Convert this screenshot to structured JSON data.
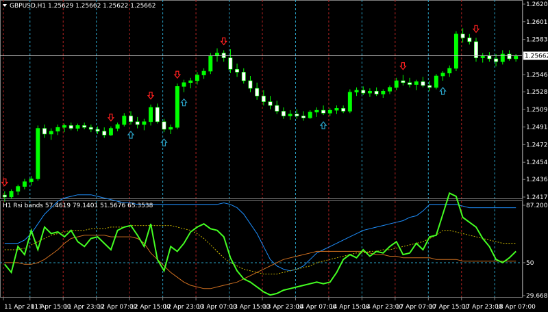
{
  "colors": {
    "background": "#000000",
    "grid": "#1f2a3a",
    "bull_candle": "#00ff00",
    "bear_candle": "#ffffff",
    "wick": "#00ff00",
    "separator_bull": "#2aa4c9",
    "separator_bear": "#b22222",
    "price_line": "#c0c0c0",
    "rsi": "#44ff22",
    "upper_band": "#1e90ff",
    "middle_band": "#c8b400",
    "lower_band": "#d07020",
    "level_line": "#2aa4c9",
    "arrow_up": "#2aa4c9",
    "arrow_down": "#ff2020",
    "frame": "#808080"
  },
  "main_chart": {
    "header": "GBPUSD,H1  1.25629 1.25662 1.25622 1.25662",
    "symbol_menu_icon": "triangle-down-icon",
    "current_price": "1.25662",
    "price_levels": [
      {
        "label": "1.26204",
        "value": 1.26204
      },
      {
        "label": "1.26019",
        "value": 1.26019
      },
      {
        "label": "1.25833",
        "value": 1.25833
      },
      {
        "label": "1.25662",
        "value": 1.25662
      },
      {
        "label": "1.25464",
        "value": 1.25464
      },
      {
        "label": "1.25284",
        "value": 1.25284
      },
      {
        "label": "1.25099",
        "value": 1.25099
      },
      {
        "label": "1.24914",
        "value": 1.24914
      },
      {
        "label": "1.24729",
        "value": 1.24729
      },
      {
        "label": "1.24544",
        "value": 1.24544
      },
      {
        "label": "1.24364",
        "value": 1.24364
      },
      {
        "label": "1.24179",
        "value": 1.24179
      }
    ]
  },
  "indicator": {
    "header": "H1 Rsi bands 57.4619 79.1401 51.5676 65.3538",
    "levels": [
      {
        "label": "87.2005",
        "value": 87.2005
      },
      {
        "label": "50",
        "value": 50
      },
      {
        "label": "29.6680",
        "value": 29.668
      }
    ]
  },
  "time_axis": {
    "labels": [
      "11 Apr 2017",
      "11 Apr 15:00",
      "11 Apr 23:00",
      "12 Apr 07:00",
      "12 Apr 15:00",
      "12 Apr 23:00",
      "13 Apr 07:00",
      "13 Apr 15:00",
      "13 Apr 23:00",
      "14 Apr 07:00",
      "14 Apr 15:00",
      "14 Apr 23:00",
      "17 Apr 07:00",
      "17 Apr 15:00",
      "17 Apr 23:00",
      "18 Apr 07:00"
    ]
  },
  "chart_data": {
    "type": "candlestick",
    "symbol": "GBPUSD",
    "timeframe": "H1",
    "ohlc_header": [
      1.25629,
      1.25662,
      1.25622,
      1.25662
    ],
    "ylim": [
      1.24179,
      1.26204
    ],
    "candles": [
      [
        1.242,
        1.2424,
        1.2413,
        1.2418
      ],
      [
        1.2418,
        1.2426,
        1.2416,
        1.2424
      ],
      [
        1.2424,
        1.2431,
        1.242,
        1.2429
      ],
      [
        1.2429,
        1.2437,
        1.2426,
        1.2434
      ],
      [
        1.2434,
        1.244,
        1.243,
        1.2437
      ],
      [
        1.2437,
        1.2493,
        1.2435,
        1.249
      ],
      [
        1.249,
        1.2494,
        1.248,
        1.2484
      ],
      [
        1.2484,
        1.249,
        1.2478,
        1.2487
      ],
      [
        1.2487,
        1.2494,
        1.2483,
        1.2491
      ],
      [
        1.2491,
        1.2495,
        1.2486,
        1.2493
      ],
      [
        1.2493,
        1.2496,
        1.2488,
        1.249
      ],
      [
        1.249,
        1.2495,
        1.2487,
        1.2493
      ],
      [
        1.2493,
        1.2496,
        1.2489,
        1.2491
      ],
      [
        1.2491,
        1.2494,
        1.2486,
        1.2489
      ],
      [
        1.2489,
        1.2492,
        1.2484,
        1.2487
      ],
      [
        1.2487,
        1.2491,
        1.248,
        1.2483
      ],
      [
        1.2483,
        1.2492,
        1.2482,
        1.249
      ],
      [
        1.249,
        1.2496,
        1.2487,
        1.2494
      ],
      [
        1.2494,
        1.2506,
        1.2492,
        1.2503
      ],
      [
        1.2503,
        1.2508,
        1.2494,
        1.2497
      ],
      [
        1.2497,
        1.2502,
        1.249,
        1.2494
      ],
      [
        1.2494,
        1.25,
        1.2488,
        1.2497
      ],
      [
        1.2497,
        1.2515,
        1.2493,
        1.2512
      ],
      [
        1.2512,
        1.2516,
        1.2495,
        1.2497
      ],
      [
        1.2497,
        1.25,
        1.2486,
        1.2489
      ],
      [
        1.2489,
        1.2494,
        1.2484,
        1.2491
      ],
      [
        1.2491,
        1.2537,
        1.2489,
        1.2534
      ],
      [
        1.2534,
        1.2541,
        1.2528,
        1.2538
      ],
      [
        1.2538,
        1.2543,
        1.2532,
        1.254
      ],
      [
        1.254,
        1.2549,
        1.2536,
        1.2546
      ],
      [
        1.2546,
        1.2553,
        1.2542,
        1.255
      ],
      [
        1.255,
        1.2569,
        1.2547,
        1.2566
      ],
      [
        1.2566,
        1.2574,
        1.256,
        1.2569
      ],
      [
        1.2569,
        1.2572,
        1.256,
        1.2564
      ],
      [
        1.2564,
        1.2573,
        1.2548,
        1.2552
      ],
      [
        1.2552,
        1.2558,
        1.2544,
        1.2549
      ],
      [
        1.2549,
        1.2553,
        1.2537,
        1.254
      ],
      [
        1.254,
        1.2545,
        1.2528,
        1.2532
      ],
      [
        1.2532,
        1.2538,
        1.252,
        1.2524
      ],
      [
        1.2524,
        1.253,
        1.2514,
        1.2518
      ],
      [
        1.2518,
        1.2524,
        1.251,
        1.2514
      ],
      [
        1.2514,
        1.2519,
        1.2505,
        1.2508
      ],
      [
        1.2508,
        1.2512,
        1.25,
        1.2503
      ],
      [
        1.2503,
        1.2509,
        1.2499,
        1.2505
      ],
      [
        1.2505,
        1.251,
        1.25,
        1.2503
      ],
      [
        1.2503,
        1.2508,
        1.2498,
        1.2501
      ],
      [
        1.2501,
        1.2509,
        1.25,
        1.2507
      ],
      [
        1.2507,
        1.2512,
        1.2502,
        1.2509
      ],
      [
        1.2509,
        1.2514,
        1.2504,
        1.2506
      ],
      [
        1.2506,
        1.2511,
        1.2503,
        1.2509
      ],
      [
        1.2509,
        1.2514,
        1.2505,
        1.2511
      ],
      [
        1.2511,
        1.2514,
        1.2506,
        1.2508
      ],
      [
        1.2508,
        1.2531,
        1.2506,
        1.2528
      ],
      [
        1.2528,
        1.2533,
        1.2524,
        1.253
      ],
      [
        1.253,
        1.2534,
        1.2525,
        1.2527
      ],
      [
        1.2527,
        1.2532,
        1.2523,
        1.2529
      ],
      [
        1.2529,
        1.2533,
        1.2524,
        1.2526
      ],
      [
        1.2526,
        1.2531,
        1.2522,
        1.2529
      ],
      [
        1.2529,
        1.2535,
        1.2526,
        1.2533
      ],
      [
        1.2533,
        1.2543,
        1.253,
        1.254
      ],
      [
        1.254,
        1.2546,
        1.2535,
        1.2538
      ],
      [
        1.2538,
        1.2543,
        1.2533,
        1.2536
      ],
      [
        1.2536,
        1.2541,
        1.253,
        1.2539
      ],
      [
        1.2539,
        1.2544,
        1.2533,
        1.2535
      ],
      [
        1.2535,
        1.254,
        1.2529,
        1.2533
      ],
      [
        1.2533,
        1.2547,
        1.2531,
        1.2545
      ],
      [
        1.2545,
        1.255,
        1.254,
        1.2548
      ],
      [
        1.2548,
        1.2556,
        1.2544,
        1.2553
      ],
      [
        1.2553,
        1.2592,
        1.255,
        1.2589
      ],
      [
        1.2589,
        1.2595,
        1.258,
        1.2585
      ],
      [
        1.2585,
        1.2589,
        1.2578,
        1.2581
      ],
      [
        1.2581,
        1.2585,
        1.256,
        1.2564
      ],
      [
        1.2564,
        1.2569,
        1.2559,
        1.2566
      ],
      [
        1.2566,
        1.257,
        1.256,
        1.2563
      ],
      [
        1.2563,
        1.2568,
        1.2555,
        1.256
      ],
      [
        1.256,
        1.2572,
        1.2557,
        1.2568
      ],
      [
        1.2568,
        1.2572,
        1.2561,
        1.2563
      ],
      [
        1.2563,
        1.2568,
        1.256,
        1.2566
      ]
    ],
    "arrows_down": [
      0,
      16,
      22,
      26,
      33,
      60,
      71
    ],
    "arrows_up": [
      19,
      24,
      27,
      48,
      66
    ],
    "indicator_series": {
      "rsi": [
        49,
        44,
        60,
        55,
        70,
        58,
        72,
        68,
        69,
        66,
        70,
        63,
        60,
        65,
        66,
        62,
        58,
        70,
        72,
        73,
        67,
        60,
        74,
        52,
        45,
        60,
        57,
        62,
        69,
        72,
        74,
        71,
        70,
        66,
        53,
        45,
        40,
        38,
        35,
        32,
        30,
        31,
        33,
        34,
        35,
        36,
        37,
        38,
        37,
        38,
        44,
        52,
        55,
        53,
        58,
        54,
        57,
        56,
        60,
        63,
        55,
        56,
        62,
        58,
        66,
        67,
        80,
        93,
        91,
        78,
        75,
        72,
        65,
        60,
        52,
        50,
        53,
        57
      ],
      "upper": [
        62,
        62,
        62,
        64,
        68,
        74,
        80,
        84,
        88,
        90,
        91,
        92,
        92,
        92,
        91,
        90,
        89,
        88,
        87,
        87,
        86,
        86,
        86,
        86,
        86,
        86,
        86,
        86,
        86,
        86,
        86,
        86,
        86,
        87,
        86,
        84,
        80,
        74,
        68,
        60,
        52,
        48,
        46,
        45,
        46,
        48,
        52,
        56,
        58,
        60,
        62,
        64,
        66,
        68,
        70,
        71,
        72,
        73,
        74,
        75,
        76,
        78,
        79,
        82,
        86,
        86,
        86,
        86,
        86,
        85,
        84,
        84,
        84,
        84,
        84,
        84,
        84,
        84
      ],
      "middle": [
        58,
        58,
        58,
        59,
        61,
        63,
        65,
        67,
        68,
        69,
        70,
        70,
        70,
        71,
        71,
        71,
        72,
        72,
        72,
        73,
        73,
        73,
        73,
        73,
        73,
        73,
        72,
        71,
        70,
        68,
        65,
        61,
        57,
        53,
        50,
        48,
        46,
        45,
        44,
        43,
        43,
        43,
        44,
        45,
        46,
        47,
        48,
        50,
        51,
        52,
        53,
        54,
        55,
        56,
        56,
        57,
        57,
        58,
        58,
        59,
        60,
        61,
        62,
        63,
        65,
        67,
        70,
        70,
        69,
        68,
        67,
        66,
        65,
        64,
        63,
        62,
        62,
        62
      ],
      "lower": [
        50,
        50,
        50,
        49,
        49,
        50,
        52,
        55,
        58,
        62,
        65,
        66,
        67,
        67,
        67,
        67,
        66,
        66,
        66,
        66,
        65,
        62,
        56,
        52,
        48,
        44,
        41,
        38,
        36,
        35,
        34,
        34,
        35,
        36,
        37,
        38,
        40,
        42,
        44,
        46,
        48,
        50,
        52,
        53,
        54,
        55,
        56,
        57,
        57,
        57,
        57,
        57,
        57,
        57,
        57,
        56,
        55,
        55,
        54,
        54,
        53,
        53,
        53,
        53,
        53,
        52,
        52,
        52,
        52,
        51,
        51,
        51,
        51,
        51,
        51,
        51,
        51,
        51
      ]
    }
  }
}
